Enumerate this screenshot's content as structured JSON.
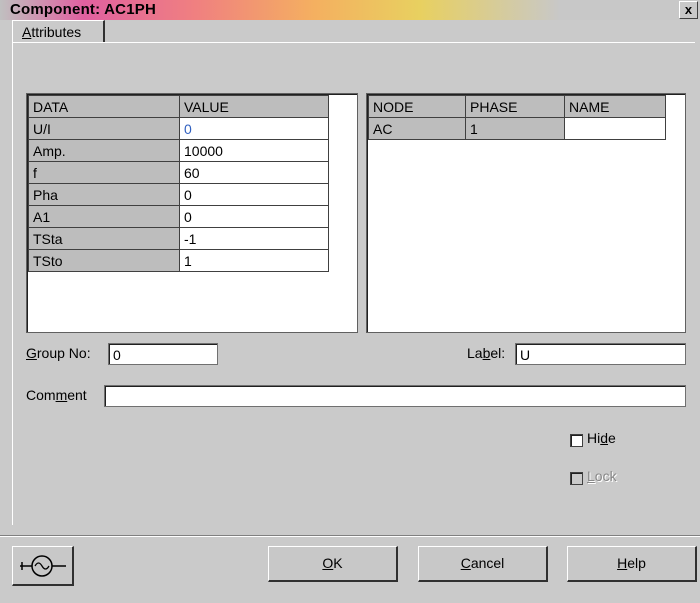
{
  "window": {
    "title": "Component: AC1PH",
    "close_glyph": "x"
  },
  "tab": {
    "label_prefix": "",
    "label_accel": "A",
    "label_rest": "ttributes"
  },
  "attributes_table": {
    "headers": [
      "DATA",
      "VALUE"
    ],
    "rows": [
      {
        "key": "U/I",
        "value": "0"
      },
      {
        "key": "Amp.",
        "value": "10000"
      },
      {
        "key": "f",
        "value": "60"
      },
      {
        "key": "Pha",
        "value": "0"
      },
      {
        "key": "A1",
        "value": "0"
      },
      {
        "key": "TSta",
        "value": "-1"
      },
      {
        "key": "TSto",
        "value": "1"
      }
    ]
  },
  "node_table": {
    "headers": [
      "NODE",
      "PHASE",
      "NAME"
    ],
    "rows": [
      {
        "node": "AC",
        "phase": "1",
        "name": ""
      }
    ]
  },
  "group": {
    "label_accel": "G",
    "label_rest": "roup No:",
    "value": "0"
  },
  "label_field": {
    "label_pre": "La",
    "label_accel": "b",
    "label_rest": "el:",
    "value": "U"
  },
  "comment": {
    "label_pre": "Com",
    "label_accel": "m",
    "label_rest": "ent",
    "value": ""
  },
  "hide": {
    "label_pre": "Hi",
    "label_accel": "d",
    "label_rest": "e",
    "checked": false
  },
  "lock": {
    "label_accel": "L",
    "label_rest": "ock",
    "checked": false,
    "disabled": true
  },
  "buttons": {
    "ok": {
      "accel": "O",
      "rest": "K"
    },
    "cancel": {
      "accel": "C",
      "rest": "ancel"
    },
    "help": {
      "accel": "H",
      "rest": "elp"
    }
  },
  "component_icon": "ac-source-icon"
}
